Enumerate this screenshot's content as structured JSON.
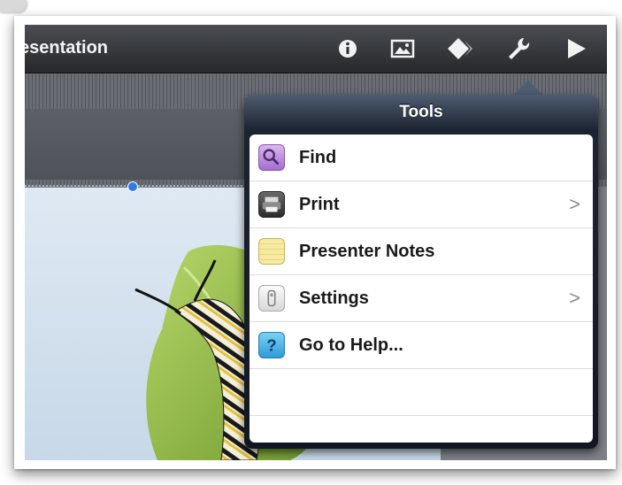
{
  "toolbar": {
    "title": "esentation",
    "icons": [
      "info-icon",
      "media-icon",
      "animate-icon",
      "tools-wrench-icon",
      "play-icon"
    ]
  },
  "popover": {
    "title": "Tools",
    "items": [
      {
        "label": "Find",
        "icon": "find-icon",
        "chevron": false
      },
      {
        "label": "Print",
        "icon": "printer-icon",
        "chevron": true,
        "chevron_glyph": ">"
      },
      {
        "label": "Presenter Notes",
        "icon": "notes-icon",
        "chevron": false
      },
      {
        "label": "Settings",
        "icon": "settings-icon",
        "chevron": true,
        "chevron_glyph": ">"
      },
      {
        "label": "Go to Help...",
        "icon": "help-icon",
        "chevron": false
      }
    ]
  },
  "colors": {
    "toolbar_bg": "#2f3236",
    "popover_header": "#4e5b70",
    "selection_handle": "#2e7be8"
  }
}
